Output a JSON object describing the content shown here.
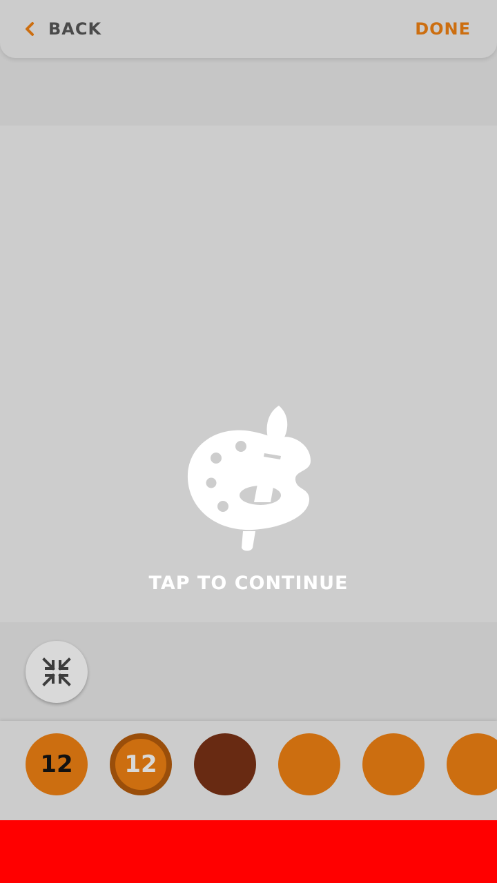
{
  "header": {
    "back_label": "BACK",
    "done_label": "DONE",
    "accent_color": "#cc6e10",
    "back_icon": "chevron-left-icon"
  },
  "canvas": {
    "message": "TAP TO CONTINUE",
    "icon": "paint-palette-icon"
  },
  "tools": {
    "shrink_icon": "shrink-arrows-icon"
  },
  "palette": {
    "swatches": [
      {
        "color": "#cc6e10",
        "label": "12",
        "text_color": "#111111",
        "selected": false
      },
      {
        "color": "#cc6e10",
        "label": "12",
        "text_color": "#d8d8d8",
        "selected": true
      },
      {
        "color": "#682a12",
        "label": "",
        "selected": false
      },
      {
        "color": "#cc6e10",
        "label": "",
        "selected": false
      },
      {
        "color": "#cc6e10",
        "label": "",
        "selected": false
      },
      {
        "color": "#cc6e10",
        "label": "",
        "selected": false
      }
    ]
  },
  "ad": {
    "color": "#ff0000"
  }
}
